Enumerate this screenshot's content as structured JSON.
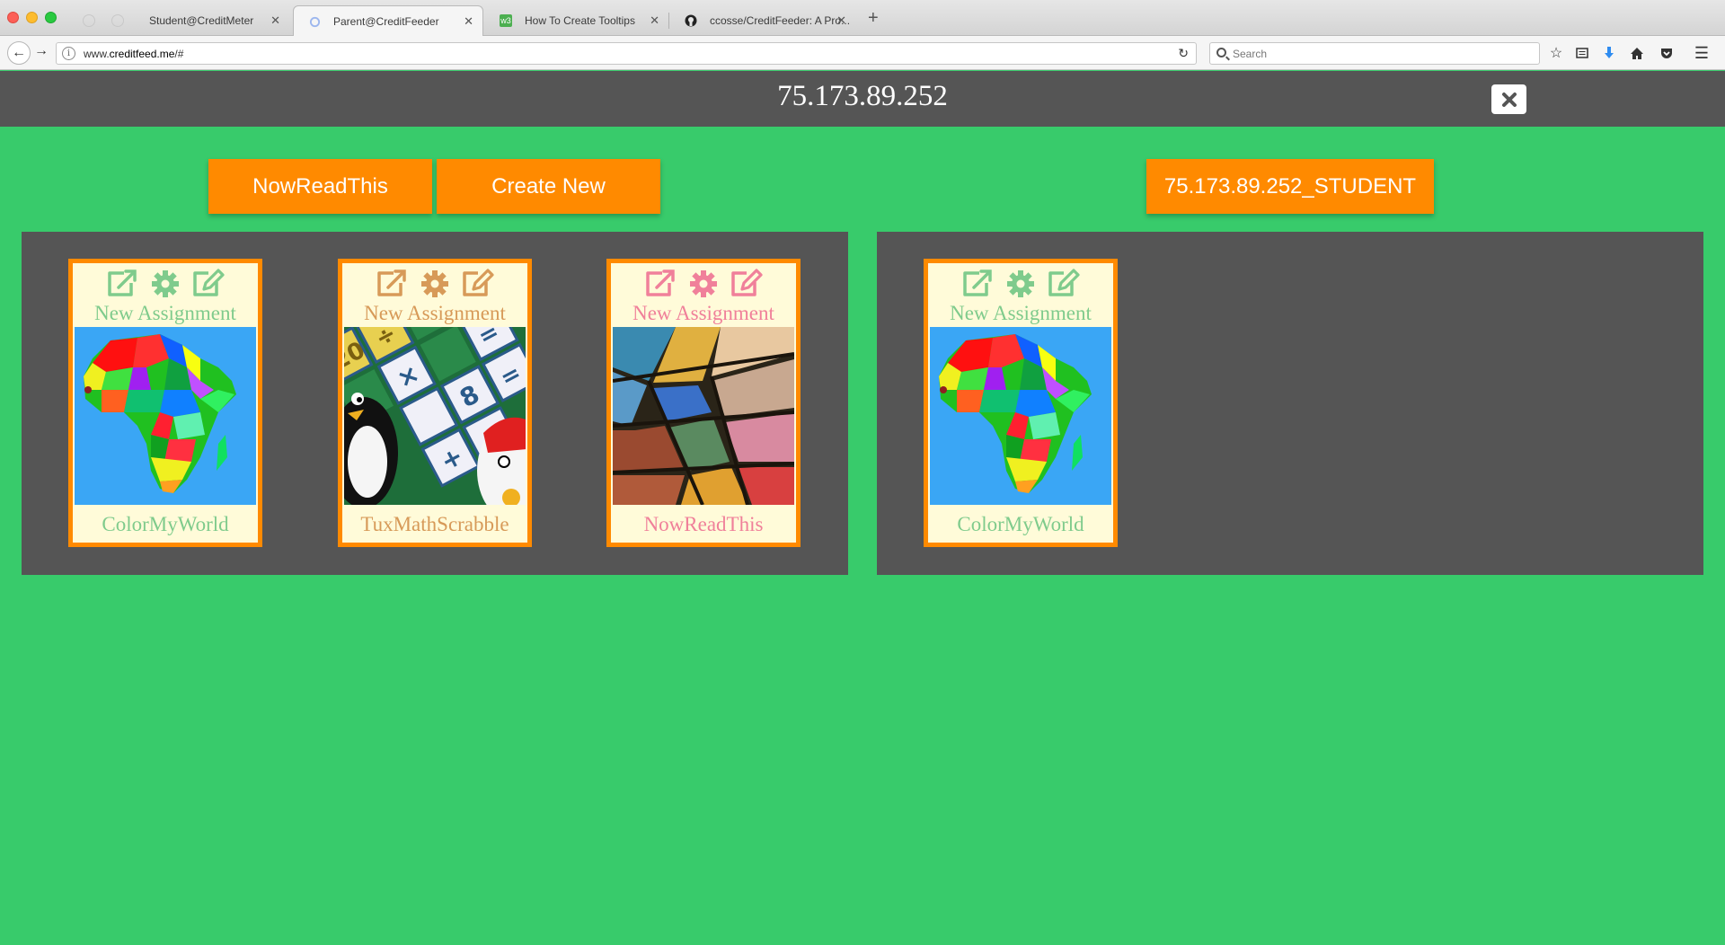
{
  "browser": {
    "tabs": [
      {
        "label": "Student@CreditMeter",
        "active": false
      },
      {
        "label": "Parent@CreditFeeder",
        "active": true
      },
      {
        "label": "How To Create Tooltips",
        "active": false
      },
      {
        "label": "ccosse/CreditFeeder: A Pro...",
        "active": false
      }
    ],
    "url_prefix": "www.",
    "url_domain": "creditfeed.me",
    "url_suffix": "/#",
    "search_placeholder": "Search"
  },
  "header": {
    "title": "75.173.89.252"
  },
  "toolbar": {
    "nowreadthis_label": "NowReadThis",
    "create_new_label": "Create New",
    "student_label": "75.173.89.252_STUDENT"
  },
  "colors": {
    "background": "#38cb6b",
    "header_bg": "#555555",
    "button_orange": "#ff8a00",
    "card_bg": "#fffbd9",
    "green_theme": "#7fcb8c",
    "tan_theme": "#d79a58",
    "pink_theme": "#f0809a"
  },
  "parent_panel": {
    "cards": [
      {
        "header": "New Assignment",
        "footer": "ColorMyWorld",
        "theme": "green",
        "image": "africa-map"
      },
      {
        "header": "New Assignment",
        "footer": "TuxMathScrabble",
        "theme": "tan",
        "image": "tux-math"
      },
      {
        "header": "New Assignment",
        "footer": "NowReadThis",
        "theme": "pink",
        "image": "stained-glass"
      }
    ]
  },
  "student_panel": {
    "cards": [
      {
        "header": "New Assignment",
        "footer": "ColorMyWorld",
        "theme": "green",
        "image": "africa-map"
      }
    ]
  }
}
